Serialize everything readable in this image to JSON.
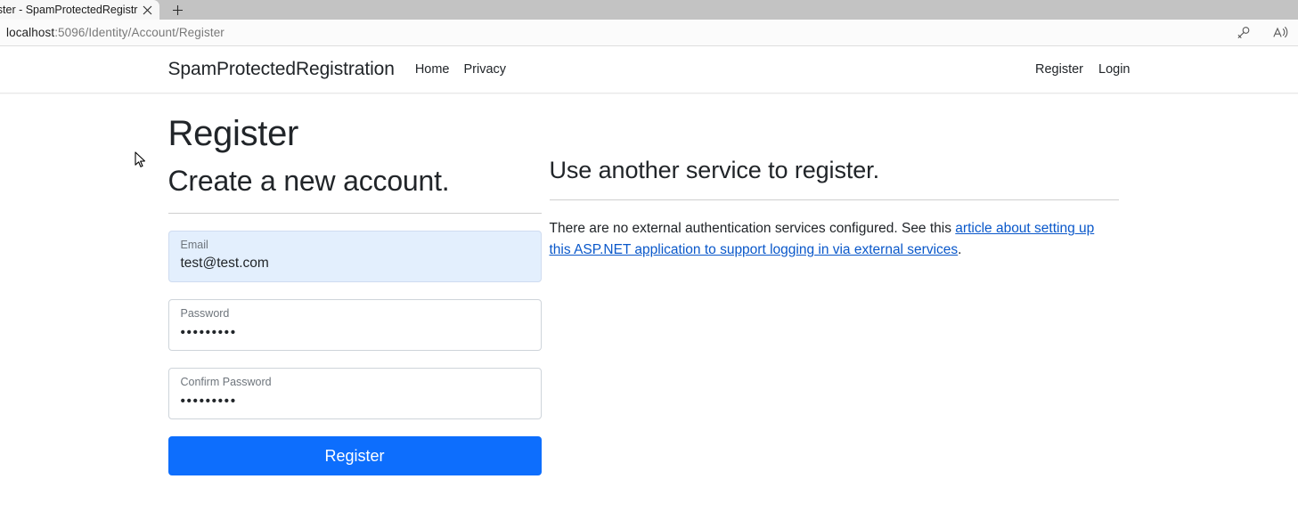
{
  "browser": {
    "tab": {
      "title": "ister - SpamProtectedRegistr",
      "close_icon": "close-icon",
      "new_tab_icon": "plus-icon"
    },
    "address": {
      "host": "localhost",
      "path": ":5096/Identity/Account/Register",
      "full_url": "localhost:5096/Identity/Account/Register"
    },
    "toolbar_icons": [
      {
        "name": "key-icon",
        "title": "Saved passwords"
      },
      {
        "name": "read-aloud-icon",
        "title": "Read aloud"
      }
    ]
  },
  "navbar": {
    "brand": "SpamProtectedRegistration",
    "links": [
      {
        "label": "Home"
      },
      {
        "label": "Privacy"
      }
    ],
    "right_links": [
      {
        "label": "Register"
      },
      {
        "label": "Login"
      }
    ]
  },
  "main": {
    "title": "Register",
    "subtitle": "Create a new account.",
    "form": {
      "fields": [
        {
          "label": "Email",
          "value": "test@test.com",
          "type": "email",
          "autofilled": true
        },
        {
          "label": "Password",
          "value": "•••••••••",
          "type": "password",
          "autofilled": false
        },
        {
          "label": "Confirm Password",
          "value": "•••••••••",
          "type": "password",
          "autofilled": false
        }
      ],
      "submit_label": "Register"
    },
    "external": {
      "title": "Use another service to register.",
      "text_before": "There are no external authentication services configured. See this ",
      "link_text": "article about setting up this ASP.NET application to support logging in via external services",
      "text_after": "."
    }
  },
  "colors": {
    "accent_blue": "#0d6efd",
    "link_blue": "#0a58ca",
    "autofill_blue": "#e3effd",
    "text_dark": "#212529",
    "muted": "#6e757c",
    "tabstrip_gray": "#c3c3c3"
  }
}
